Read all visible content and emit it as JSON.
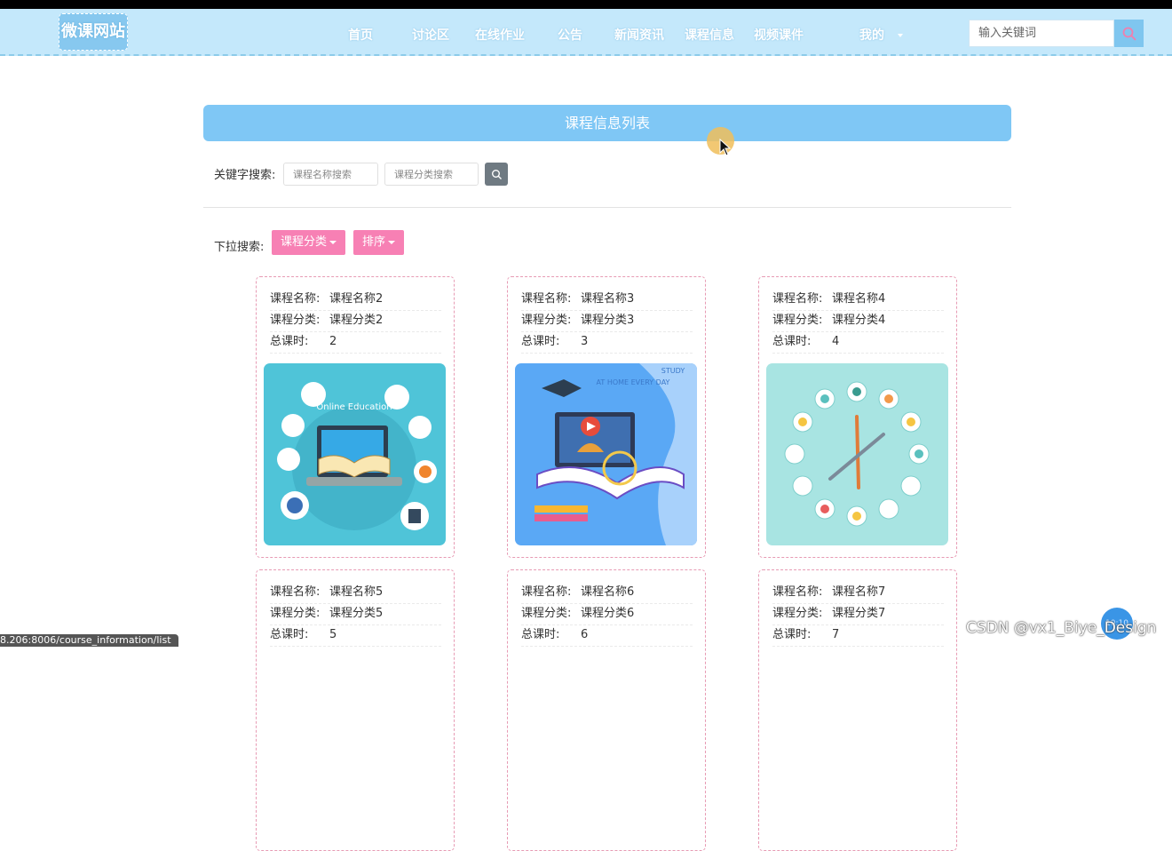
{
  "header": {
    "logo_text": "微课网站",
    "nav": [
      "首页",
      "讨论区",
      "在线作业",
      "公告",
      "新闻资讯",
      "课程信息",
      "视频课件",
      "我的"
    ],
    "search_placeholder": "输入关键词"
  },
  "page": {
    "title": "课程信息列表",
    "keyword_label": "关键字搜索:",
    "name_search_placeholder": "课程名称搜索",
    "category_search_placeholder": "课程分类搜索",
    "dropdown_label": "下拉搜索:",
    "category_dropdown": "课程分类",
    "sort_dropdown": "排序"
  },
  "course_field_labels": {
    "name": "课程名称:",
    "category": "课程分类:",
    "hours": "总课时:"
  },
  "courses": [
    {
      "name": "课程名称2",
      "category": "课程分类2",
      "hours": "2",
      "image_icon": "online-education-illustration"
    },
    {
      "name": "课程名称3",
      "category": "课程分类3",
      "hours": "3",
      "image_icon": "study-at-home-illustration"
    },
    {
      "name": "课程名称4",
      "category": "课程分类4",
      "hours": "4",
      "image_icon": "education-clock-illustration"
    },
    {
      "name": "课程名称5",
      "category": "课程分类5",
      "hours": "5"
    },
    {
      "name": "课程名称6",
      "category": "课程分类6",
      "hours": "6"
    },
    {
      "name": "课程名称7",
      "category": "课程分类7",
      "hours": "7"
    }
  ],
  "illustration_text": {
    "online": "Online Education",
    "study": "STUDY",
    "home": "AT HOME EVERY DAY"
  },
  "status_url": "8.206:8006/course_information/list",
  "watermark": "CSDN @vx1_Biye_Design",
  "float_button_text": "10:10",
  "colors": {
    "header_bg": "#c4e8fb",
    "title_bar": "#7fc7f5",
    "pink_button": "#f780b4",
    "card_border": "#e79bb4"
  }
}
